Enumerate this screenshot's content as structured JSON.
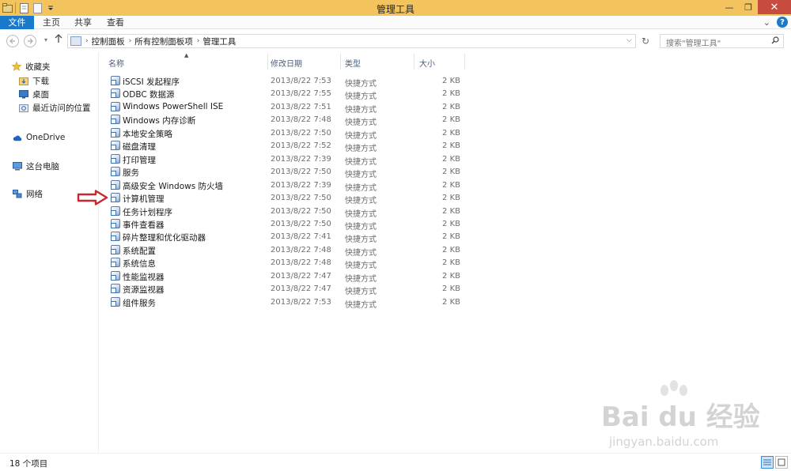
{
  "window": {
    "title": "管理工具",
    "minimize_glyph": "—",
    "restore_glyph": "❐",
    "close_glyph": "✕"
  },
  "ribbon": {
    "tabs": [
      "文件",
      "主页",
      "共享",
      "查看"
    ],
    "expand_glyph": "⌄",
    "help_glyph": "?"
  },
  "address": {
    "breadcrumbs": [
      "控制面板",
      "所有控制面板项",
      "管理工具"
    ],
    "search_placeholder": "搜索\"管理工具\""
  },
  "navpane": {
    "favorites": "收藏夹",
    "favorites_items": [
      "下载",
      "桌面",
      "最近访问的位置"
    ],
    "onedrive": "OneDrive",
    "thispc": "这台电脑",
    "network": "网络"
  },
  "columns": {
    "name": "名称",
    "date": "修改日期",
    "type": "类型",
    "size": "大小"
  },
  "files": [
    {
      "name": "iSCSI 发起程序",
      "date": "2013/8/22 7:53",
      "type": "快捷方式",
      "size": "2 KB"
    },
    {
      "name": "ODBC 数据源",
      "date": "2013/8/22 7:55",
      "type": "快捷方式",
      "size": "2 KB"
    },
    {
      "name": "Windows PowerShell ISE",
      "date": "2013/8/22 7:51",
      "type": "快捷方式",
      "size": "2 KB"
    },
    {
      "name": "Windows 内存诊断",
      "date": "2013/8/22 7:48",
      "type": "快捷方式",
      "size": "2 KB"
    },
    {
      "name": "本地安全策略",
      "date": "2013/8/22 7:50",
      "type": "快捷方式",
      "size": "2 KB"
    },
    {
      "name": "磁盘清理",
      "date": "2013/8/22 7:52",
      "type": "快捷方式",
      "size": "2 KB"
    },
    {
      "name": "打印管理",
      "date": "2013/8/22 7:39",
      "type": "快捷方式",
      "size": "2 KB"
    },
    {
      "name": "服务",
      "date": "2013/8/22 7:50",
      "type": "快捷方式",
      "size": "2 KB"
    },
    {
      "name": "高级安全 Windows 防火墙",
      "date": "2013/8/22 7:39",
      "type": "快捷方式",
      "size": "2 KB"
    },
    {
      "name": "计算机管理",
      "date": "2013/8/22 7:50",
      "type": "快捷方式",
      "size": "2 KB"
    },
    {
      "name": "任务计划程序",
      "date": "2013/8/22 7:50",
      "type": "快捷方式",
      "size": "2 KB"
    },
    {
      "name": "事件查看器",
      "date": "2013/8/22 7:50",
      "type": "快捷方式",
      "size": "2 KB"
    },
    {
      "name": "碎片整理和优化驱动器",
      "date": "2013/8/22 7:41",
      "type": "快捷方式",
      "size": "2 KB"
    },
    {
      "name": "系统配置",
      "date": "2013/8/22 7:48",
      "type": "快捷方式",
      "size": "2 KB"
    },
    {
      "name": "系统信息",
      "date": "2013/8/22 7:48",
      "type": "快捷方式",
      "size": "2 KB"
    },
    {
      "name": "性能监视器",
      "date": "2013/8/22 7:47",
      "type": "快捷方式",
      "size": "2 KB"
    },
    {
      "name": "资源监视器",
      "date": "2013/8/22 7:47",
      "type": "快捷方式",
      "size": "2 KB"
    },
    {
      "name": "组件服务",
      "date": "2013/8/22 7:53",
      "type": "快捷方式",
      "size": "2 KB"
    }
  ],
  "status": {
    "item_count": "18 个项目"
  },
  "watermark": {
    "brand": "Bai du 经验",
    "site": "jingyan.baidu.com"
  },
  "colors": {
    "titlebar": "#f3c45d",
    "file_tab": "#1979ca",
    "close_button": "#c74b3f",
    "annotation_arrow": "#c8282d"
  }
}
